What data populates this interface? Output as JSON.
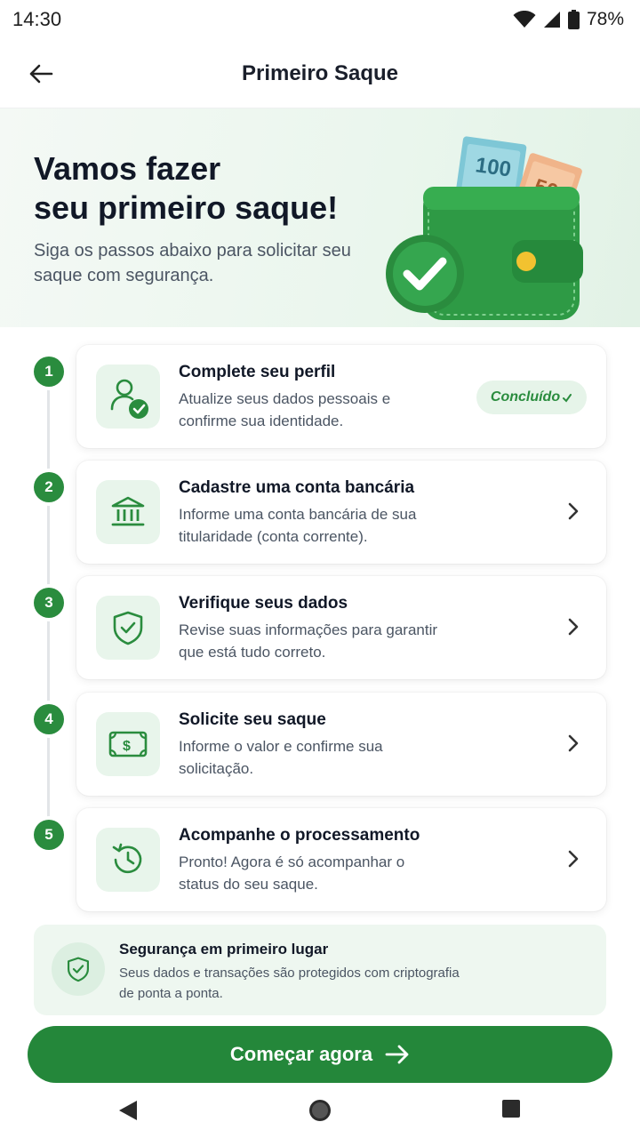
{
  "status_bar": {
    "time": "14:30",
    "battery": "78%"
  },
  "app_bar": {
    "title": "Primeiro Saque",
    "back_icon": "arrow-left-icon"
  },
  "hero": {
    "title_line1": "Vamos fazer",
    "title_line2": "seu primeiro saque!",
    "subtitle": "Siga os passos abaixo para solicitar seu saque com segurança.",
    "illustration": "wallet-with-money-icon",
    "banknote_values": [
      "100",
      "50"
    ]
  },
  "steps": [
    {
      "number": "1",
      "title": "Complete seu perfil",
      "description": "Atualize seus dados pessoais e confirme sua identidade.",
      "icon": "user-check-icon",
      "status": "Concluído",
      "completed": true
    },
    {
      "number": "2",
      "title": "Cadastre uma conta bancária",
      "description": "Informe uma conta bancária de sua titularidade (conta corrente).",
      "icon": "bank-icon",
      "completed": false
    },
    {
      "number": "3",
      "title": "Verifique seus dados",
      "description": "Revise suas informações para garantir que está tudo correto.",
      "icon": "shield-check-icon",
      "completed": false
    },
    {
      "number": "4",
      "title": "Solicite seu saque",
      "description": "Informe o valor e confirme sua solicitação.",
      "icon": "cash-icon",
      "completed": false
    },
    {
      "number": "5",
      "title": "Acompanhe o processamento",
      "description": "Pronto! Agora é só acompanhar o status do seu saque.",
      "icon": "clock-history-icon",
      "completed": false
    }
  ],
  "security": {
    "title": "Segurança em primeiro lugar",
    "description": "Seus dados e transações são protegidos com criptografia de ponta a ponta.",
    "icon": "shield-check-icon"
  },
  "cta": {
    "label": "Começar agora",
    "icon": "arrow-right-icon"
  },
  "colors": {
    "primary": "#2a8c3e",
    "primary_light": "#e8f5eb",
    "text_dark": "#111827",
    "text_muted": "#4b5563"
  }
}
